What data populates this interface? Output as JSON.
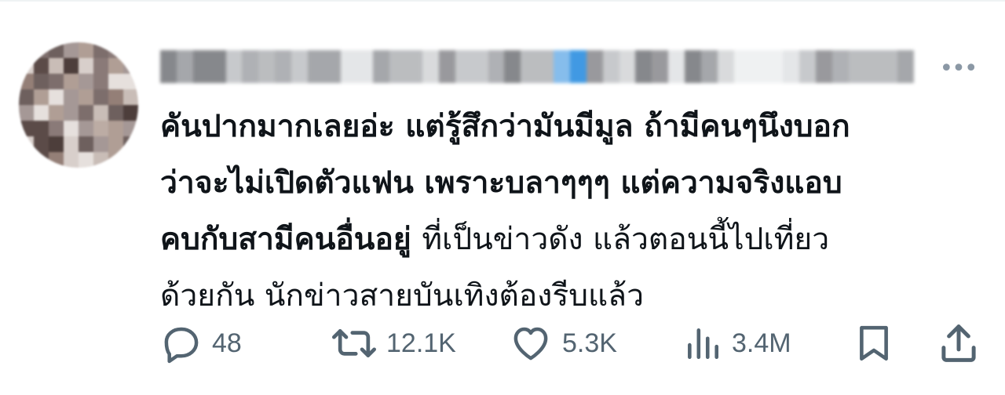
{
  "tweet": {
    "text_lines": [
      "คันปากมากเลยอ่ะ แต่รู้สึกว่ามันมีมูล ถ้ามีคนๆนึงบอก",
      "ว่าจะไม่เปิดตัวแฟน เพราะบลาๆๆๆ แต่ความจริงแอบ",
      "คบกับสามีคนอื่นอยู่",
      "ที่เป็นข่าวดัง แล้วตอนนี้ไปเที่ยว",
      "ด้วยกัน นักข่าวสายบันเทิงต้องรีบแล้ว"
    ],
    "more_label": "•••"
  },
  "actions": {
    "reply": {
      "icon": "reply-icon",
      "count": "48"
    },
    "retweet": {
      "icon": "retweet-icon",
      "count": "12.1K"
    },
    "like": {
      "icon": "heart-icon",
      "count": "5.3K"
    },
    "views": {
      "icon": "views-chart-icon",
      "count": "3.4M"
    },
    "bookmark": {
      "icon": "bookmark-icon"
    },
    "share": {
      "icon": "share-icon"
    }
  },
  "colors": {
    "text": "#0f1419",
    "muted": "#536471",
    "divider": "#eff3f4"
  }
}
